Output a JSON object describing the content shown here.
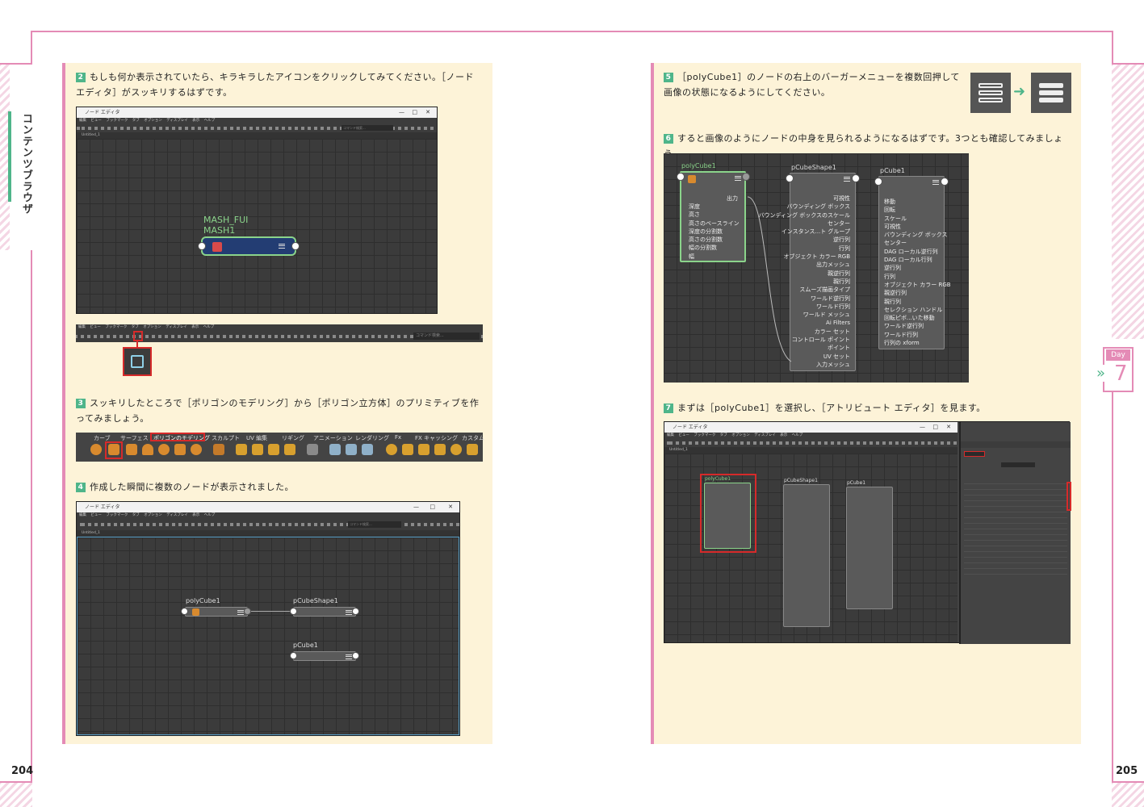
{
  "side_title": "コンテンツブラウザ",
  "page_left": "204",
  "page_right": "205",
  "day_badge": {
    "label": "Day",
    "number": "7",
    "arrow": "»"
  },
  "steps": [
    {
      "num": "2",
      "text": "もしも何か表示されていたら、キラキラしたアイコンをクリックしてみてください。［ノード エディタ］がスッキリするはずです。"
    },
    {
      "num": "3",
      "text": "スッキリしたところで［ポリゴンのモデリング］から［ポリゴン立方体］のプリミティブを作ってみましょう。"
    },
    {
      "num": "4",
      "text": "作成した瞬間に複数のノードが表示されました。"
    },
    {
      "num": "5",
      "text": "［polyCube1］のノードの右上のバーガーメニューを複数回押して画像の状態になるようにしてください。"
    },
    {
      "num": "6",
      "text": "すると画像のようにノードの中身を見られるようになるはずです。3つとも確認してみましょう。"
    },
    {
      "num": "7",
      "text": "まずは［polyCube1］を選択し、［アトリビュート エディタ］を見ます。"
    }
  ],
  "window": {
    "title": "ノード エディタ",
    "menu": "編集 ビュー ブックマーク タブ オプション ディスプレイ 表示 ヘルプ",
    "tab": "Untitled_1",
    "search_placeholder": "コマンド検索...",
    "min": "—",
    "max": "□",
    "close": "✕"
  },
  "mash_node": {
    "label1": "MASH_FUI",
    "label2": "MASH1"
  },
  "shelf_tabs": [
    "カーブ",
    "サーフェス",
    "ポリゴンのモデリング",
    "スカルプト",
    "UV 編集",
    "リギング",
    "アニメーション",
    "レンダリング",
    "Fx",
    "FX キャッシング",
    "カスタム"
  ],
  "nodes": {
    "poly": "polyCube1",
    "shape": "pCubeShape1",
    "cube": "pCube1"
  },
  "poly_attrs": {
    "out": "出力",
    "list": [
      "深度",
      "高さ",
      "高さのベースライン",
      "深度の分割数",
      "高さの分割数",
      "幅の分割数",
      "幅"
    ]
  },
  "shape_attrs": [
    "可視性",
    "バウンディング ボックス",
    "バウンディング ボックスのスケール",
    "センター",
    "インスタンス...ト グループ",
    "逆行列",
    "行列",
    "オブジェクト カラー RGB",
    "出力メッシュ",
    "親逆行列",
    "親行列",
    "スムーズ描画タイプ",
    "ワールド逆行列",
    "ワールド行列",
    "ワールド メッシュ",
    "Ai Filters",
    "カラー セット",
    "コントロール ポイント",
    "ポイント",
    "UV セット",
    "入力メッシュ"
  ],
  "cube_attrs": [
    "移動",
    "回転",
    "スケール",
    "可視性",
    "バウンディング ボックス",
    "センター",
    "DAG ローカル逆行列",
    "DAG ローカル行列",
    "逆行列",
    "行列",
    "オブジェクト カラー RGB",
    "親逆行列",
    "親行列",
    "セレクション ハンドル",
    "回転ピボ...いた移動",
    "ワールド逆行列",
    "ワールド行列",
    "行列の xform"
  ]
}
